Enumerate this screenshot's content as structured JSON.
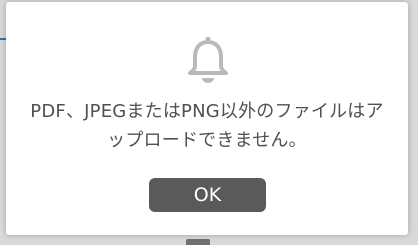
{
  "dialog": {
    "icon": "bell-icon",
    "message": "PDF、JPEGまたはPNG以外のファイルはアップロードできません。",
    "ok_label": "OK"
  },
  "colors": {
    "icon": "#b9b9b9",
    "text": "#505050",
    "button_bg": "#5a5a5a",
    "button_text": "#ffffff"
  }
}
